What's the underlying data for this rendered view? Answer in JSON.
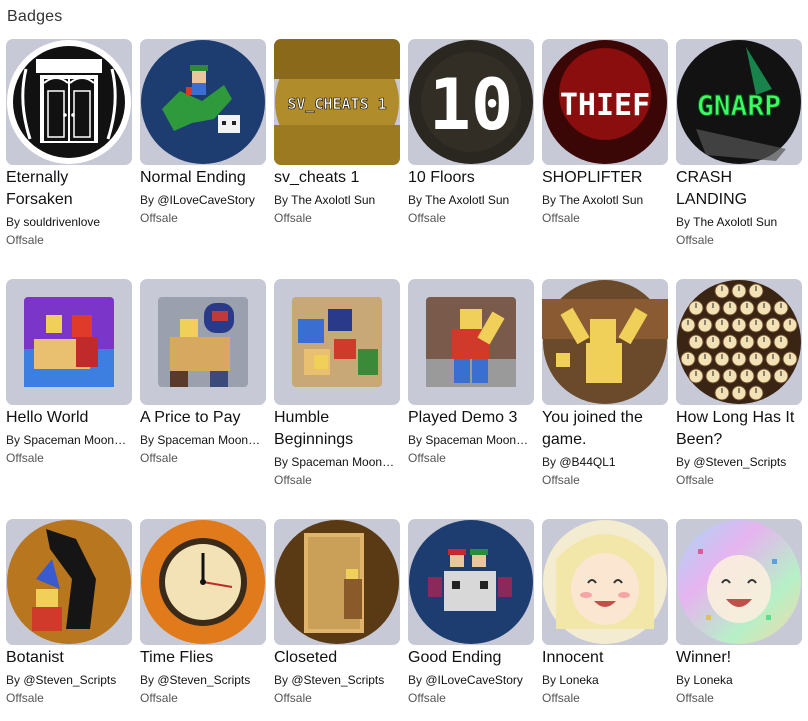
{
  "section": {
    "title": "Badges"
  },
  "badges": [
    {
      "name": "Eternally Forsaken",
      "by": "By",
      "creator": "souldrivenlove",
      "status": "Offsale",
      "icon": "gothic-window-door-icon"
    },
    {
      "name": "Normal Ending",
      "by": "By",
      "creator": "@ILoveCaveStory",
      "status": "Offsale",
      "icon": "pixel-dragon-rider-icon"
    },
    {
      "name": "sv_cheats 1",
      "by": "By",
      "creator": "The Axolotl Sun",
      "status": "Offsale",
      "icon": "sv-cheats-text-icon",
      "art_text": "SV_CHEATS 1"
    },
    {
      "name": "10 Floors",
      "by": "By",
      "creator": "The Axolotl Sun",
      "status": "Offsale",
      "icon": "ten-digits-icon",
      "art_text": "10"
    },
    {
      "name": "SHOPLIFTER",
      "by": "By",
      "creator": "The Axolotl Sun",
      "status": "Offsale",
      "icon": "thief-text-icon",
      "art_text": "THIEF"
    },
    {
      "name": "CRASH LANDING",
      "by": "By",
      "creator": "The Axolotl Sun",
      "status": "Offsale",
      "icon": "gnarp-text-icon",
      "art_text": "GNARP"
    },
    {
      "name": "Hello World",
      "by": "By",
      "creator": "Spaceman Moon…",
      "status": "Offsale",
      "icon": "hugging-figures-icon"
    },
    {
      "name": "A Price to Pay",
      "by": "By",
      "creator": "Spaceman Moon…",
      "status": "Offsale",
      "icon": "hooded-figure-carry-icon"
    },
    {
      "name": "Humble Beginnings",
      "by": "By",
      "creator": "Spaceman Moon…",
      "status": "Offsale",
      "icon": "blocks-scene-icon"
    },
    {
      "name": "Played Demo 3",
      "by": "By",
      "creator": "Spaceman Moon…",
      "status": "Offsale",
      "icon": "blocky-figure-icon"
    },
    {
      "name": "You joined the game.",
      "by": "By",
      "creator": "@B44QL1",
      "status": "Offsale",
      "icon": "figure-arms-up-icon"
    },
    {
      "name": "How Long Has It Been?",
      "by": "By",
      "creator": "@Steven_Scripts",
      "status": "Offsale",
      "icon": "many-clocks-icon"
    },
    {
      "name": "Botanist",
      "by": "By",
      "creator": "@Steven_Scripts",
      "status": "Offsale",
      "icon": "wizard-tree-icon"
    },
    {
      "name": "Time Flies",
      "by": "By",
      "creator": "@Steven_Scripts",
      "status": "Offsale",
      "icon": "wall-clock-icon"
    },
    {
      "name": "Closeted",
      "by": "By",
      "creator": "@Steven_Scripts",
      "status": "Offsale",
      "icon": "closet-door-icon"
    },
    {
      "name": "Good Ending",
      "by": "By",
      "creator": "@ILoveCaveStory",
      "status": "Offsale",
      "icon": "pixel-robot-icon"
    },
    {
      "name": "Innocent",
      "by": "By",
      "creator": "Loneka",
      "status": "Offsale",
      "icon": "smiling-girl-icon"
    },
    {
      "name": "Winner!",
      "by": "By",
      "creator": "Loneka",
      "status": "Offsale",
      "icon": "confetti-girl-icon"
    }
  ]
}
